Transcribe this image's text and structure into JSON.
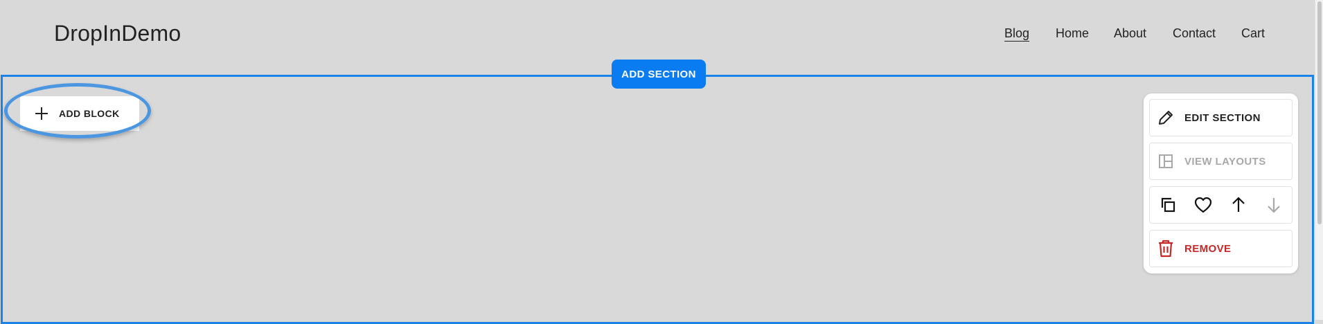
{
  "header": {
    "site_title": "DropInDemo",
    "nav": [
      {
        "label": "Blog",
        "active": true
      },
      {
        "label": "Home",
        "active": false
      },
      {
        "label": "About",
        "active": false
      },
      {
        "label": "Contact",
        "active": false
      },
      {
        "label": "Cart",
        "active": false
      }
    ]
  },
  "editor": {
    "add_section_label": "ADD SECTION",
    "add_block_label": "ADD BLOCK",
    "section_panel": {
      "edit_section_label": "EDIT SECTION",
      "view_layouts_label": "VIEW LAYOUTS",
      "remove_label": "REMOVE",
      "icons": [
        "duplicate-icon",
        "heart-icon",
        "arrow-up-icon",
        "arrow-down-icon"
      ]
    }
  },
  "colors": {
    "accent": "#0a7cf2",
    "section_outline": "#1b82e6",
    "highlight_ring": "#4b96e0",
    "danger": "#c62828",
    "disabled": "#a8a8a8",
    "page_background": "#d9d9d9"
  }
}
